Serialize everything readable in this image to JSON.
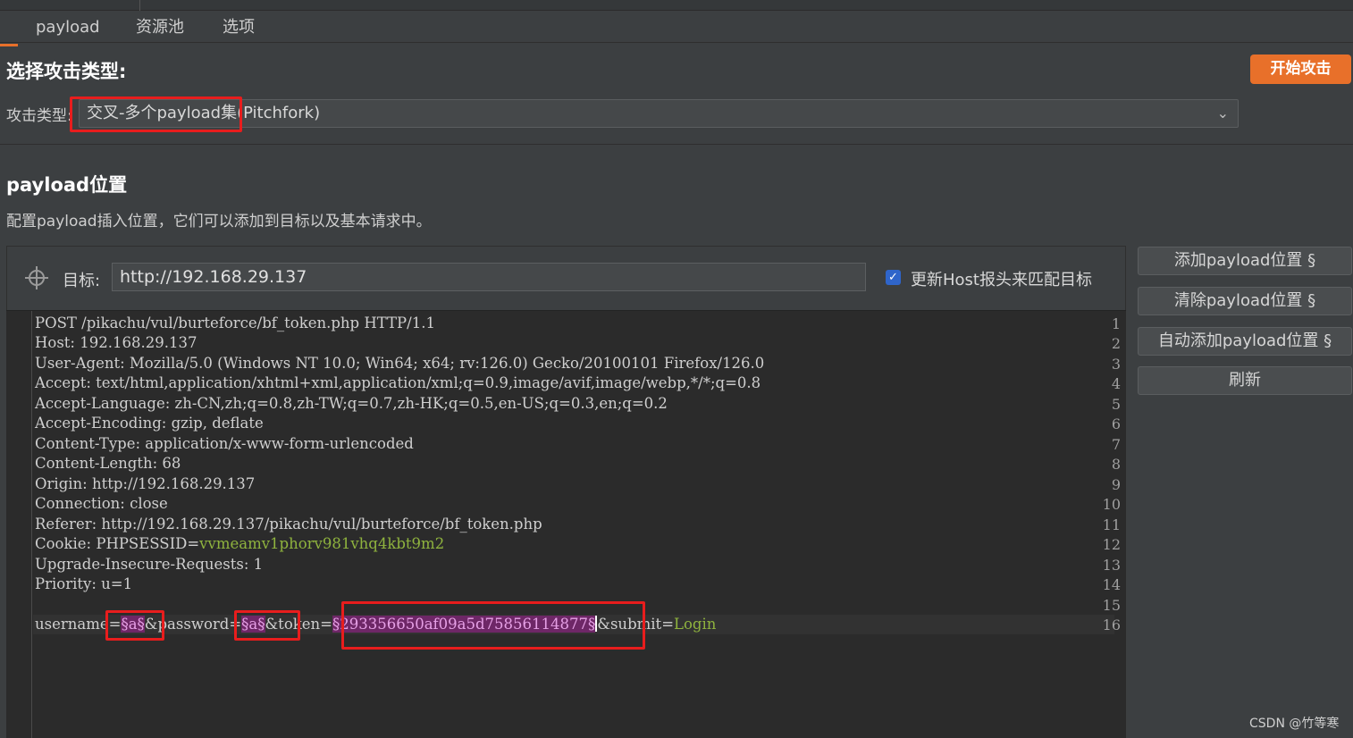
{
  "tabs": [
    {
      "label": "payload"
    },
    {
      "label": "资源池"
    },
    {
      "label": "选项"
    }
  ],
  "attack_type_section": {
    "title": "选择攻击类型:",
    "start_button": "开始攻击",
    "label": "攻击类型:",
    "selected_value": "交叉-多个payload集(Pitchfork)"
  },
  "positions_section": {
    "title": "payload位置",
    "description": "配置payload插入位置，它们可以添加到目标以及基本请求中。",
    "target_label": "目标:",
    "target_url": "http://192.168.29.137",
    "update_host_checked": true,
    "update_host_label": "更新Host报头来匹配目标"
  },
  "side_buttons": [
    {
      "label": "添加payload位置 §"
    },
    {
      "label": "清除payload位置 §"
    },
    {
      "label": "自动添加payload位置 §"
    },
    {
      "label": "刷新"
    }
  ],
  "request_lines": [
    {
      "n": "1",
      "text": "POST /pikachu/vul/burteforce/bf_token.php HTTP/1.1"
    },
    {
      "n": "2",
      "text": "Host: 192.168.29.137"
    },
    {
      "n": "3",
      "text": "User-Agent: Mozilla/5.0 (Windows NT 10.0; Win64; x64; rv:126.0) Gecko/20100101 Firefox/126.0"
    },
    {
      "n": "4",
      "text": "Accept: text/html,application/xhtml+xml,application/xml;q=0.9,image/avif,image/webp,*/*;q=0.8"
    },
    {
      "n": "5",
      "text": "Accept-Language: zh-CN,zh;q=0.8,zh-TW;q=0.7,zh-HK;q=0.5,en-US;q=0.3,en;q=0.2"
    },
    {
      "n": "6",
      "text": "Accept-Encoding: gzip, deflate"
    },
    {
      "n": "7",
      "text": "Content-Type: application/x-www-form-urlencoded"
    },
    {
      "n": "8",
      "text": "Content-Length: 68"
    },
    {
      "n": "9",
      "text": "Origin: http://192.168.29.137"
    },
    {
      "n": "10",
      "text": "Connection: close"
    },
    {
      "n": "11",
      "text": "Referer: http://192.168.29.137/pikachu/vul/burteforce/bf_token.php"
    },
    {
      "n": "12",
      "text": "Cookie: PHPSESSID=",
      "value": "vvmeamv1phorv981vhq4kbt9m2"
    },
    {
      "n": "13",
      "text": "Upgrade-Insecure-Requests: 1"
    },
    {
      "n": "14",
      "text": "Priority: u=1"
    },
    {
      "n": "15",
      "text": ""
    },
    {
      "n": "16",
      "text": ""
    }
  ],
  "body_line": {
    "k1": "username",
    "eq": "=",
    "p1": "§a§",
    "k2": "&password",
    "p2": "§a§",
    "k3": "&token",
    "p3": "§293356650af09a5d75856114877§",
    "k4": "&submit",
    "v4": "Login"
  },
  "watermark": "CSDN @竹等寒",
  "colors": {
    "accent": "#e8702a",
    "highlight_box": "#e81d1d",
    "payload_marker": "#6e2767",
    "value_green": "#8fb33e"
  }
}
